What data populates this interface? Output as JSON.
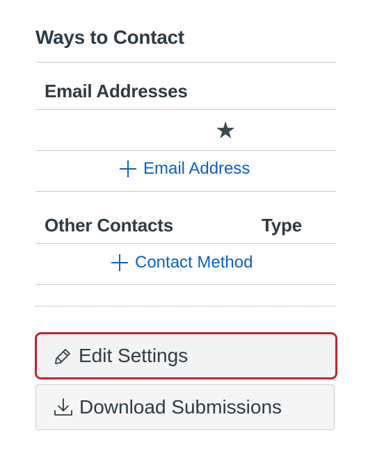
{
  "ways_to_contact": {
    "title": "Ways to Contact"
  },
  "email_table": {
    "header": "Email Addresses",
    "default_marker": "★",
    "add_label": "Email Address"
  },
  "other_table": {
    "header_contacts": "Other Contacts",
    "header_type": "Type",
    "add_label": "Contact Method"
  },
  "buttons": {
    "edit_settings": "Edit Settings",
    "download_submissions": "Download Submissions"
  },
  "colors": {
    "link": "#0b5fc4",
    "highlight_border": "#c1222f",
    "text": "#2d3b45"
  },
  "icons": {
    "star": "star-icon",
    "plus": "plus-icon",
    "pencil": "pencil-icon",
    "download": "download-icon"
  }
}
